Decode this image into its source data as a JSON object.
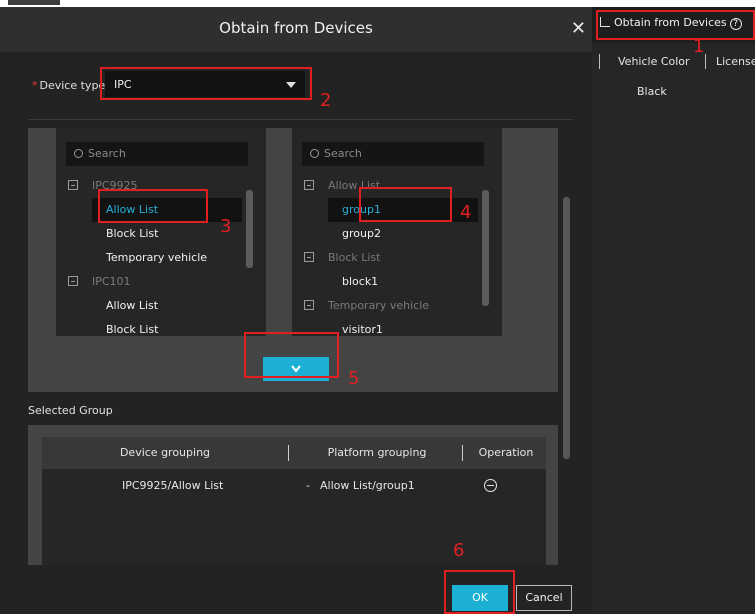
{
  "dialog": {
    "title": "Obtain from Devices",
    "close_icon": "close-icon",
    "device_type_required": "*",
    "device_type_label": "Device type",
    "device_type_value": "IPC",
    "left_search_placeholder": "Search",
    "right_search_placeholder": "Search",
    "left_tree": [
      {
        "label": "IPC9925",
        "kind": "group"
      },
      {
        "label": "Allow List",
        "kind": "leaf",
        "selected": true
      },
      {
        "label": "Block List",
        "kind": "leaf"
      },
      {
        "label": "Temporary vehicle",
        "kind": "leaf"
      },
      {
        "label": "IPC101",
        "kind": "group"
      },
      {
        "label": "Allow List",
        "kind": "leaf"
      },
      {
        "label": "Block List",
        "kind": "leaf"
      }
    ],
    "right_tree": [
      {
        "label": "Allow List",
        "kind": "group"
      },
      {
        "label": "group1",
        "kind": "leaf",
        "selected": true
      },
      {
        "label": "group2",
        "kind": "leaf"
      },
      {
        "label": "Block List",
        "kind": "group"
      },
      {
        "label": "block1",
        "kind": "leaf"
      },
      {
        "label": "Temporary vehicle",
        "kind": "group"
      },
      {
        "label": "visitor1",
        "kind": "leaf"
      }
    ],
    "selected_group_label": "Selected Group",
    "grid_headers": {
      "device": "Device grouping",
      "platform": "Platform grouping",
      "operation": "Operation"
    },
    "grid_rows": [
      {
        "device": "IPC9925/Allow List",
        "dash": "-",
        "platform": "Allow List/group1"
      }
    ],
    "ok_label": "OK",
    "cancel_label": "Cancel"
  },
  "side_panel": {
    "obtain_label": "Obtain from Devices",
    "help_glyph": "?",
    "col_vehicle_color": "Vehicle Color",
    "col_license": "License",
    "row_vehicle_color": "Black"
  },
  "annotations": [
    "1",
    "2",
    "3",
    "4",
    "5",
    "6"
  ],
  "colors": {
    "accent": "#1bb0d4",
    "selected_text": "#29b0d8",
    "annotation": "#e02020"
  }
}
